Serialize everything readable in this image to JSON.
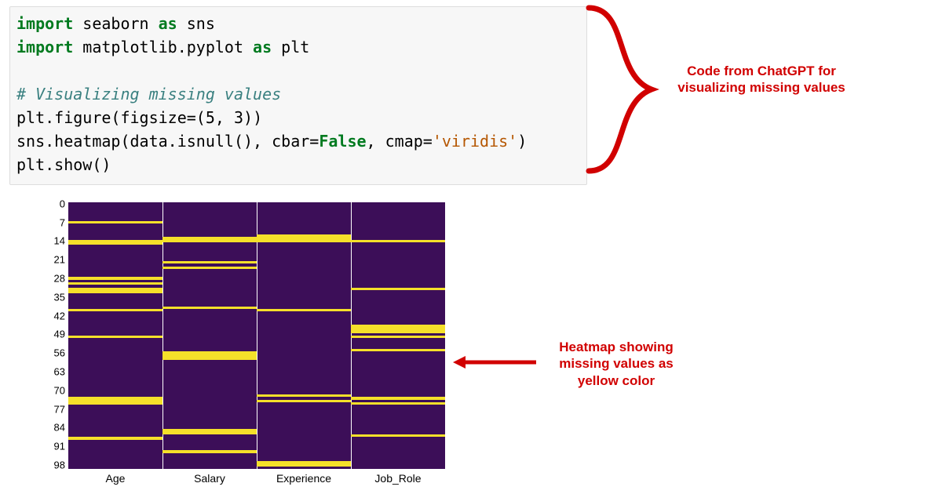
{
  "code": {
    "line1": {
      "kw": "import",
      "rest": " seaborn ",
      "kw2": "as",
      "rest2": " sns"
    },
    "line2": {
      "kw": "import",
      "rest": " matplotlib.pyplot ",
      "kw2": "as",
      "rest2": " plt"
    },
    "line3": "",
    "line4": "# Visualizing missing values",
    "line5": {
      "a": "plt.figure(figsize",
      "op": "=",
      "b": "(",
      "n1": "5",
      "c": ", ",
      "n2": "3",
      "d": "))"
    },
    "line6": {
      "a": "sns.heatmap(data.isnull(), cbar",
      "op": "=",
      "b": "False",
      "c": ", cmap",
      "op2": "=",
      "s": "'viridis'",
      "d": ")"
    },
    "line7": "plt.show()"
  },
  "annotations": {
    "top": "Code from ChatGPT for visualizing missing values",
    "mid": "Heatmap showing missing values as yellow color"
  },
  "chart_data": {
    "type": "heatmap",
    "title": "",
    "xlabel": "",
    "ylabel": "",
    "yticks": [
      "0",
      "7",
      "14",
      "21",
      "28",
      "35",
      "42",
      "49",
      "56",
      "63",
      "70",
      "77",
      "84",
      "91",
      "98"
    ],
    "xticks": [
      "Age",
      "Salary",
      "Experience",
      "Job_Role"
    ],
    "n_rows": 100,
    "n_cols": 4,
    "colors": {
      "present": "#3c0e58",
      "missing": "#f5e02a"
    },
    "missing": {
      "Age": [
        7,
        14,
        15,
        28,
        30,
        32,
        33,
        40,
        50,
        73,
        74,
        75,
        88
      ],
      "Salary": [
        13,
        14,
        22,
        24,
        39,
        56,
        57,
        58,
        85,
        86,
        93
      ],
      "Experience": [
        12,
        13,
        14,
        40,
        72,
        74,
        97,
        98
      ],
      "Job_Role": [
        14,
        32,
        46,
        47,
        48,
        50,
        55,
        73,
        75,
        87
      ]
    }
  }
}
